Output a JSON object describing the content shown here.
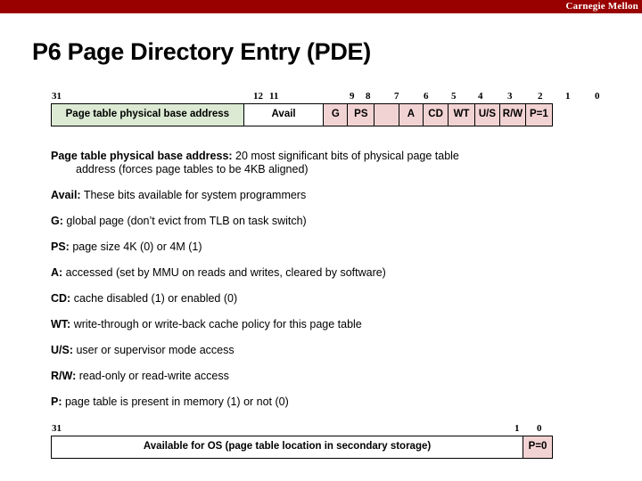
{
  "banner": {
    "brand": "Carnegie Mellon",
    "color": "#990000"
  },
  "slide": {
    "title": "P6 Page Directory Entry (PDE)"
  },
  "colors": {
    "green_field": "#dcead3",
    "pink_field": "#f2d3d3",
    "white_field": "#ffffff",
    "banner_red": "#990000"
  },
  "pde_diagram": {
    "name": "P6 Page Directory Entry present bit diagram",
    "bit_labels": [
      "31",
      "12",
      "11",
      "9",
      "8",
      "7",
      "6",
      "5",
      "4",
      "3",
      "2",
      "1",
      "0"
    ],
    "fields": [
      {
        "label": "Page table physical base address",
        "bits": "31:12",
        "fill": "green"
      },
      {
        "label": "Avail",
        "bits": "11:9",
        "fill": "white"
      },
      {
        "label": "G",
        "bits": "8",
        "fill": "pink"
      },
      {
        "label": "PS",
        "bits": "7",
        "fill": "pink"
      },
      {
        "label": "",
        "bits": "6",
        "fill": "pink"
      },
      {
        "label": "A",
        "bits": "5",
        "fill": "pink"
      },
      {
        "label": "CD",
        "bits": "4",
        "fill": "pink"
      },
      {
        "label": "WT",
        "bits": "3",
        "fill": "pink"
      },
      {
        "label": "U/S",
        "bits": "2",
        "fill": "pink"
      },
      {
        "label": "R/W",
        "bits": "1",
        "fill": "pink"
      },
      {
        "label": "P=1",
        "bits": "0",
        "fill": "pink"
      }
    ]
  },
  "not_present_diagram": {
    "name": "P6 Page Directory Entry not-present bit diagram",
    "bit_labels": [
      "31",
      "1",
      "0"
    ],
    "fields": [
      {
        "label": "Available for OS (page table location in secondary storage)",
        "bits": "31:1",
        "fill": "white"
      },
      {
        "label": "P=0",
        "bits": "0",
        "fill": "pink"
      }
    ]
  },
  "descriptions": [
    {
      "term": "Page table physical base address:",
      "text": " 20 most significant bits of physical page table",
      "continuation": "address (forces page tables to be 4KB aligned)"
    },
    {
      "term": "Avail:",
      "text": " These bits available for system programmers",
      "continuation": ""
    },
    {
      "term": "G:",
      "text": " global page (don’t evict from TLB on task switch)",
      "continuation": ""
    },
    {
      "term": "PS:",
      "text": " page size 4K (0) or 4M (1)",
      "continuation": ""
    },
    {
      "term": "A:",
      "text": " accessed (set by MMU on reads and writes, cleared by software)",
      "continuation": ""
    },
    {
      "term": "CD:",
      "text": " cache disabled (1) or enabled (0)",
      "continuation": ""
    },
    {
      "term": "WT:",
      "text": " write-through or write-back cache policy for this page table",
      "continuation": ""
    },
    {
      "term": "U/S:",
      "text": " user or supervisor mode access",
      "continuation": ""
    },
    {
      "term": "R/W:",
      "text": " read-only or read-write access",
      "continuation": ""
    },
    {
      "term": "P:",
      "text": " page table is present in memory (1) or not (0)",
      "continuation": ""
    }
  ]
}
